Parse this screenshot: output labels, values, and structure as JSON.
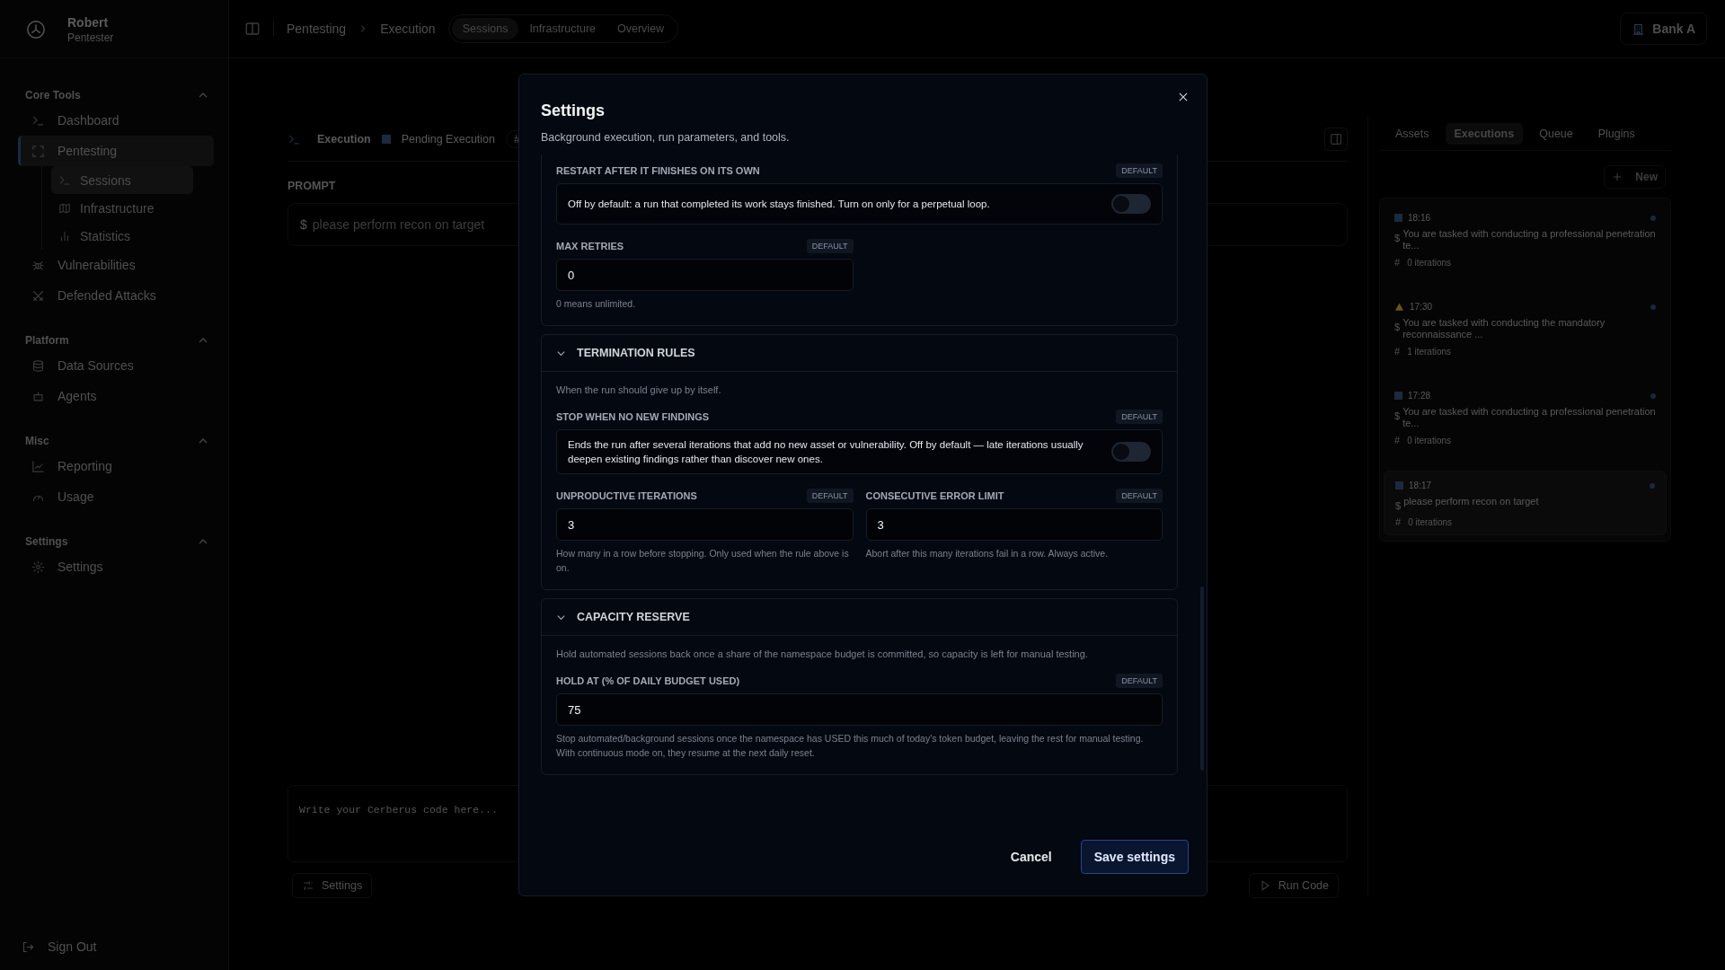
{
  "sidebar": {
    "user": {
      "name": "Robert",
      "role": "Pentester"
    },
    "groups": [
      {
        "title": "Core Tools",
        "expanded": true,
        "items": [
          {
            "label": "Dashboard",
            "selected": false
          },
          {
            "label": "Pentesting",
            "selected": true,
            "expanded": true,
            "children": [
              {
                "label": "Sessions",
                "selected": true
              },
              {
                "label": "Infrastructure",
                "selected": false
              },
              {
                "label": "Statistics",
                "selected": false
              }
            ]
          },
          {
            "label": "Vulnerabilities",
            "selected": false
          },
          {
            "label": "Defended Attacks",
            "selected": false
          }
        ]
      },
      {
        "title": "Platform",
        "expanded": true,
        "items": [
          {
            "label": "Data Sources",
            "selected": false
          },
          {
            "label": "Agents",
            "selected": false
          }
        ]
      },
      {
        "title": "Misc",
        "expanded": true,
        "items": [
          {
            "label": "Reporting",
            "selected": false
          },
          {
            "label": "Usage",
            "selected": false
          }
        ]
      },
      {
        "title": "Settings",
        "expanded": true,
        "items": [
          {
            "label": "Settings",
            "selected": false
          }
        ]
      }
    ],
    "sign_out": "Sign Out"
  },
  "top_bar": {
    "breadcrumbs": [
      "Pentesting",
      "Execution"
    ],
    "tabs": [
      {
        "label": "Sessions",
        "selected": true
      },
      {
        "label": "Infrastructure",
        "selected": false
      },
      {
        "label": "Overview",
        "selected": false
      }
    ],
    "workspace": "Bank A"
  },
  "execution": {
    "title": "Execution",
    "status": {
      "kind": "pending",
      "label": "Pending Execution"
    },
    "badge": "#",
    "prompt_label": "PROMPT",
    "prompt_prefix": "$",
    "prompt": "please perform recon on target",
    "code_placeholder": "Write your Cerberus code here...",
    "settings_button": "Settings",
    "run_button": "Run Code"
  },
  "side_panel": {
    "tabs": [
      {
        "label": "Assets",
        "selected": false
      },
      {
        "label": "Executions",
        "selected": true
      },
      {
        "label": "Queue",
        "selected": false
      },
      {
        "label": "Plugins",
        "selected": false
      }
    ],
    "new_button": "New",
    "executions": [
      {
        "kind": "pending",
        "time": "18:16",
        "prefix": "$",
        "text": "You are tasked with conducting a professional penetration te...",
        "count_prefix": "#",
        "iterations": "0 iterations",
        "selected": false
      },
      {
        "kind": "warning",
        "time": "17:30",
        "prefix": "$",
        "text": "You are tasked with conducting the mandatory reconnaissance ...",
        "count_prefix": "#",
        "iterations": "1 iterations",
        "selected": false
      },
      {
        "kind": "pending",
        "time": "17:28",
        "prefix": "$",
        "text": "You are tasked with conducting a professional penetration te...",
        "count_prefix": "#",
        "iterations": "0 iterations",
        "selected": false
      },
      {
        "kind": "pending",
        "time": "18:17",
        "prefix": "$",
        "text": "please perform recon on target",
        "count_prefix": "#",
        "iterations": "0 iterations",
        "selected": true
      }
    ]
  },
  "modal": {
    "title": "Settings",
    "subtitle": "Background execution, run parameters, and tools.",
    "sections": [
      {
        "fields": [
          {
            "kind": "toggle",
            "label": "RESTART AFTER IT FINISHES ON ITS OWN",
            "badge": "DEFAULT",
            "description": "Off by default: a run that completed its work stays finished. Turn on only for a perpetual loop.",
            "on": false
          },
          {
            "kind": "number",
            "label": "MAX RETRIES",
            "badge": "DEFAULT",
            "value": "0",
            "hint": "0 means unlimited."
          }
        ]
      },
      {
        "title": "TERMINATION RULES",
        "expanded": true,
        "description": "When the run should give up by itself.",
        "fields": [
          {
            "kind": "toggle",
            "label": "STOP WHEN NO NEW FINDINGS",
            "badge": "DEFAULT",
            "description": "Ends the run after several iterations that add no new asset or vulnerability. Off by default — late iterations usually deepen existing findings rather than discover new ones.",
            "on": false
          },
          {
            "kind": "number",
            "label": "UNPRODUCTIVE ITERATIONS",
            "badge": "DEFAULT",
            "value": "3",
            "hint": "How many in a row before stopping. Only used when the rule above is on."
          },
          {
            "kind": "number",
            "label": "CONSECUTIVE ERROR LIMIT",
            "badge": "DEFAULT",
            "value": "3",
            "hint": "Abort after this many iterations fail in a row. Always active."
          }
        ]
      },
      {
        "title": "CAPACITY RESERVE",
        "expanded": true,
        "description": "Hold automated sessions back once a share of the namespace budget is committed, so capacity is left for manual testing.",
        "fields": [
          {
            "kind": "percent",
            "label": "HOLD AT (% OF DAILY BUDGET USED)",
            "badge": "DEFAULT",
            "value": "75",
            "hint": "Stop automated/background sessions once the namespace has USED this much of today's token budget, leaving the rest for manual testing. With continuous mode on, they resume at the next daily reset."
          }
        ]
      }
    ],
    "cancel": "Cancel",
    "save": "Save settings"
  }
}
